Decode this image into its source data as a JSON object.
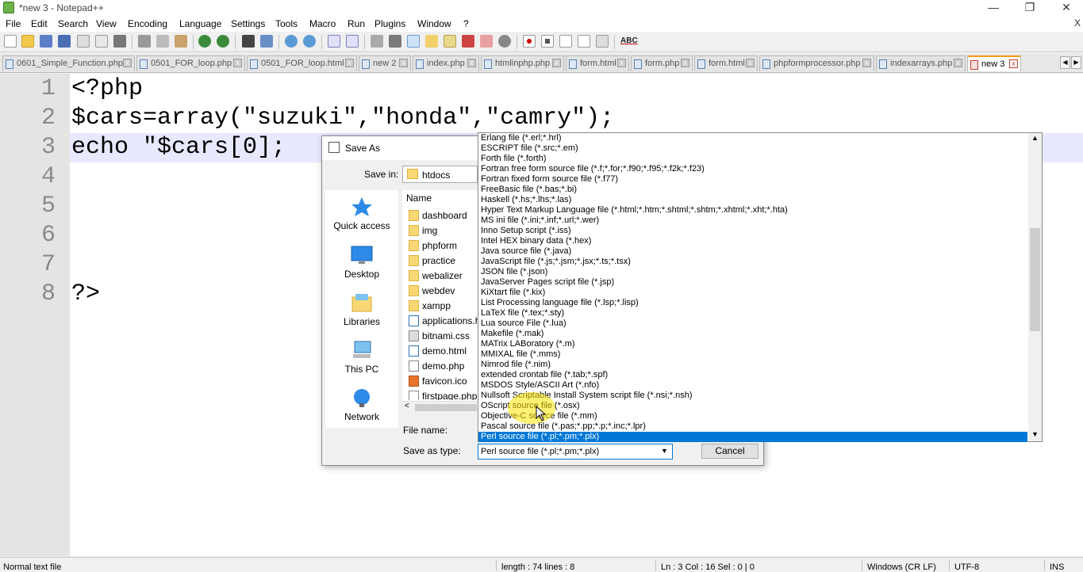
{
  "window": {
    "title": "*new 3 - Notepad++",
    "controls": [
      "—",
      "❐",
      "✕"
    ]
  },
  "menu": {
    "items": [
      "File",
      "Edit",
      "Search",
      "View",
      "Encoding",
      "Language",
      "Settings",
      "Tools",
      "Macro",
      "Run",
      "Plugins",
      "Window",
      "?"
    ],
    "close": "X"
  },
  "toolbar": {
    "spellcheck_label": "ABC"
  },
  "tabs": [
    {
      "label": "0601_Simple_Function.php"
    },
    {
      "label": "0501_FOR_loop.php"
    },
    {
      "label": "0501_FOR_loop.html"
    },
    {
      "label": "new 2"
    },
    {
      "label": "index.php"
    },
    {
      "label": "htmlinphp.php"
    },
    {
      "label": "form.html"
    },
    {
      "label": "form.php"
    },
    {
      "label": "form.html"
    },
    {
      "label": "phpformprocessor.php"
    },
    {
      "label": "indexarrays.php"
    },
    {
      "label": "new 3"
    }
  ],
  "tab_nav": {
    "prev": "◀",
    "next": "▶"
  },
  "editor": {
    "line_numbers": [
      "1",
      "2",
      "3",
      "4",
      "5",
      "6",
      "7",
      "8"
    ],
    "lines": [
      "<?php",
      "$cars=array(\"suzuki\",\"honda\",\"camry\");",
      "echo \"$cars[0];",
      "",
      "",
      "",
      "",
      "?>"
    ]
  },
  "status": {
    "file_type": "Normal text file",
    "length": "length : 74    lines : 8",
    "position": "Ln : 3    Col : 16    Sel : 0 | 0",
    "eol": "Windows (CR LF)",
    "encoding": "UTF-8",
    "mode": "INS"
  },
  "dialog": {
    "title": "Save As",
    "save_in_label": "Save in:",
    "save_in_value": "htdocs",
    "column_name": "Name",
    "nav": [
      "Quick access",
      "Desktop",
      "Libraries",
      "This PC",
      "Network"
    ],
    "files": [
      {
        "name": "dashboard",
        "kind": "folder"
      },
      {
        "name": "img",
        "kind": "folder"
      },
      {
        "name": "phpform",
        "kind": "folder"
      },
      {
        "name": "practice",
        "kind": "folder"
      },
      {
        "name": "webalizer",
        "kind": "folder"
      },
      {
        "name": "webdev",
        "kind": "folder"
      },
      {
        "name": "xampp",
        "kind": "folder"
      },
      {
        "name": "applications.h",
        "kind": "html"
      },
      {
        "name": "bitnami.css",
        "kind": "css"
      },
      {
        "name": "demo.html",
        "kind": "html"
      },
      {
        "name": "demo.php",
        "kind": "php"
      },
      {
        "name": "favicon.ico",
        "kind": "ico"
      },
      {
        "name": "firstpage.php",
        "kind": "php"
      }
    ],
    "file_name_label": "File name:",
    "save_as_type_label": "Save as type:",
    "save_as_type_value": "Perl source file (*.pl;*.pm;*.plx)",
    "cancel_label": "Cancel",
    "type_options": [
      "Erlang file (*.erl;*.hrl)",
      "ESCRIPT file (*.src;*.em)",
      "Forth file (*.forth)",
      "Fortran free form source file (*.f;*.for;*.f90;*.f95;*.f2k;*.f23)",
      "Fortran fixed form source file (*.f77)",
      "FreeBasic file (*.bas;*.bi)",
      "Haskell (*.hs;*.lhs;*.las)",
      "Hyper Text Markup Language file (*.html;*.htm;*.shtml;*.shtm;*.xhtml;*.xht;*.hta)",
      "MS ini file (*.ini;*.inf;*.url;*.wer)",
      "Inno Setup script (*.iss)",
      "Intel HEX binary data (*.hex)",
      "Java source file (*.java)",
      "JavaScript file (*.js;*.jsm;*.jsx;*.ts;*.tsx)",
      "JSON file (*.json)",
      "JavaServer Pages script file (*.jsp)",
      "KiXtart file (*.kix)",
      "List Processing language file (*.lsp;*.lisp)",
      "LaTeX file (*.tex;*.sty)",
      "Lua source File (*.lua)",
      "Makefile (*.mak)",
      "MATrix LABoratory (*.m)",
      "MMIXAL file (*.mms)",
      "Nimrod file (*.nim)",
      "extended crontab file (*.tab;*.spf)",
      "MSDOS Style/ASCII Art (*.nfo)",
      "Nullsoft Scriptable Install System script file (*.nsi;*.nsh)",
      "OScript source file (*.osx)",
      "Objective-C source file (*.mm)",
      "Pascal source file (*.pas;*.pp;*.p;*.inc;*.lpr)",
      "Perl source file (*.pl;*.pm;*.plx)"
    ],
    "selected_index": 29
  },
  "colors": {
    "selection": "#0078d7",
    "active_tab_accent": "#f39c12",
    "current_line": "#e8e8ff"
  }
}
